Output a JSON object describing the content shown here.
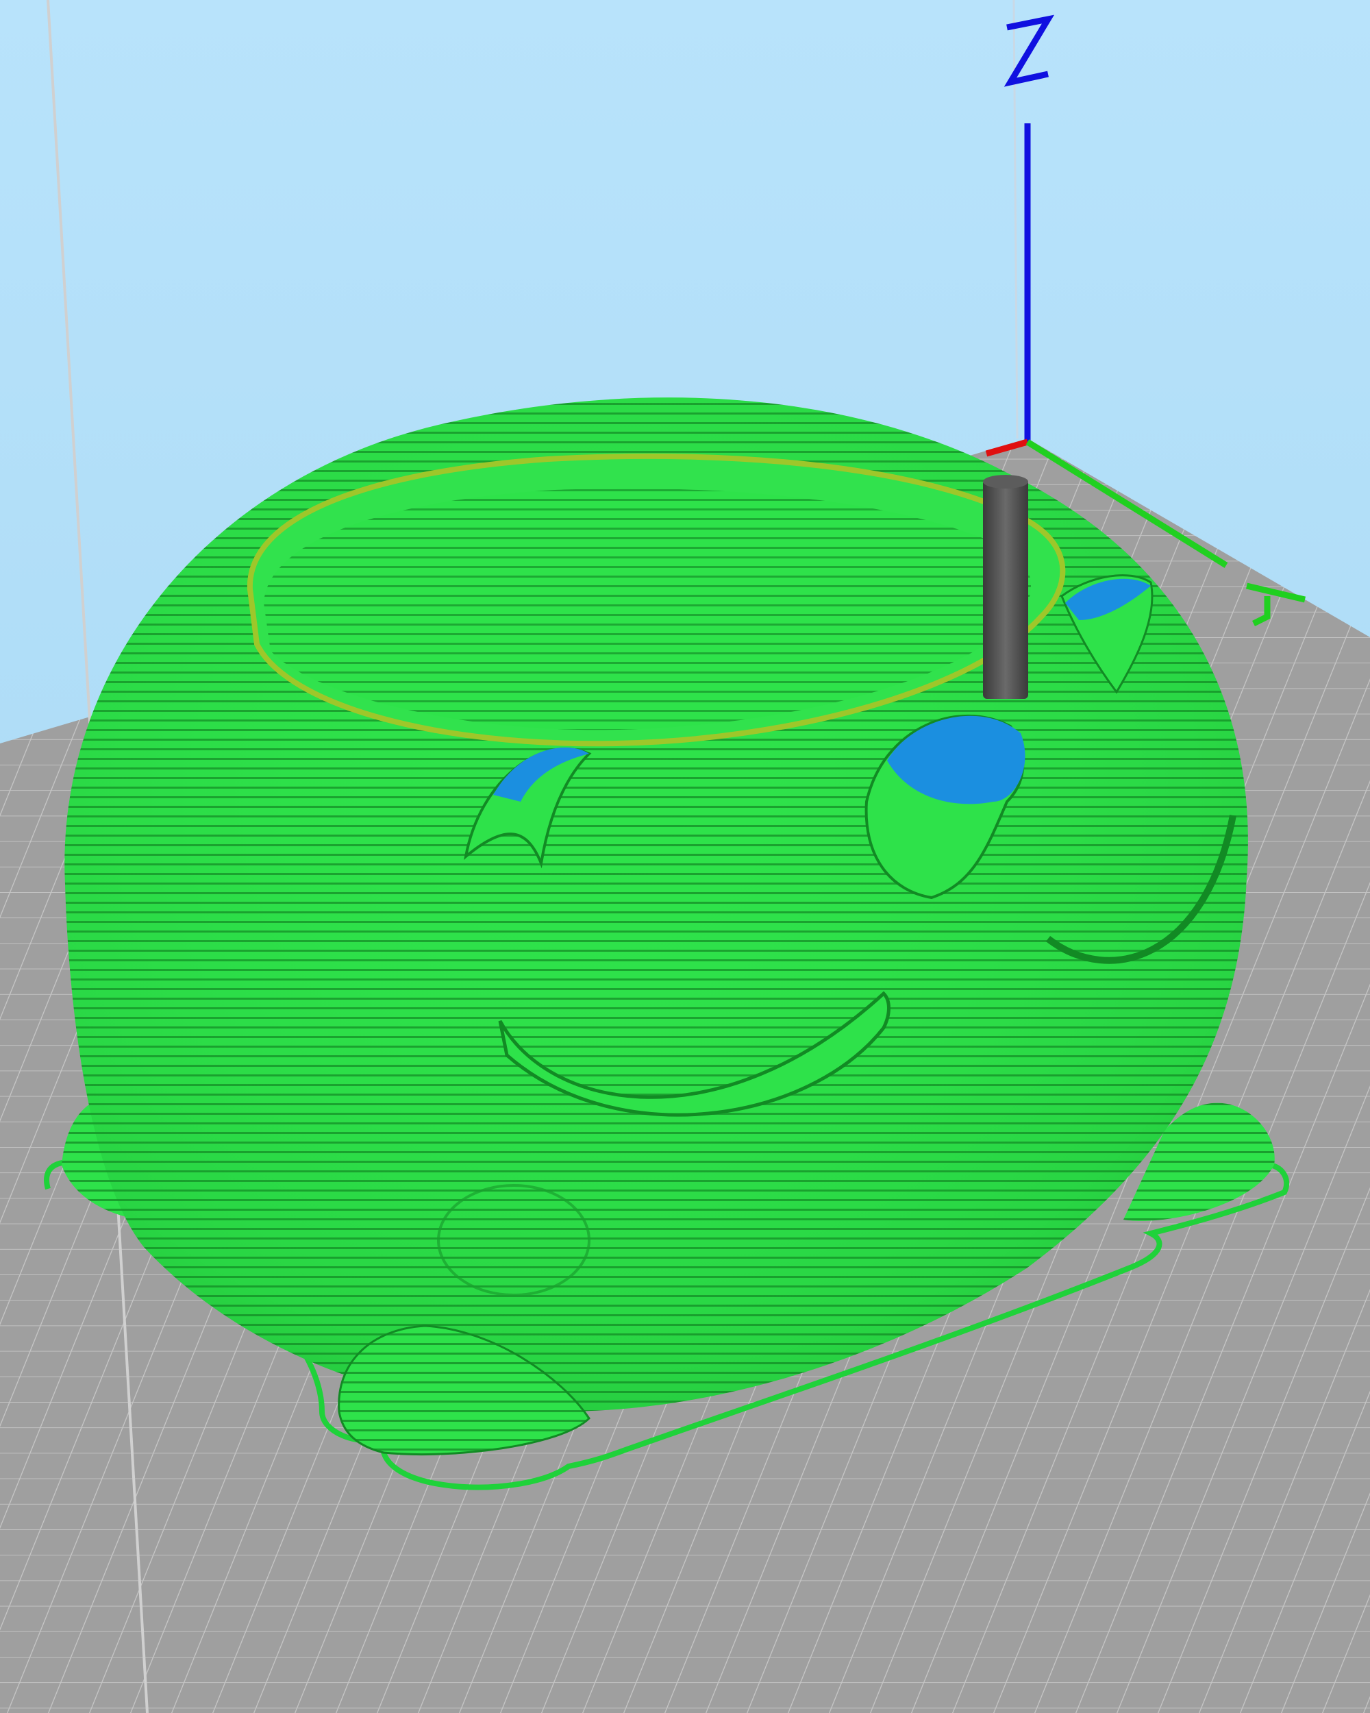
{
  "viewport": {
    "axes": {
      "z": {
        "label": "Z",
        "color": "#1010e0"
      },
      "y": {
        "label": "Y",
        "color": "#20d020"
      },
      "x": {
        "color": "#e01010"
      }
    },
    "colors": {
      "sky_top": "#b6e2fb",
      "sky_bottom": "#a6d6f3",
      "bed": "#9e9e9e",
      "bed_grid": "#bdbdbd",
      "model": "#2bdb45",
      "model_line": "#138a24",
      "overhang": "#1b8fe0",
      "nozzle": "#4a4a4a"
    },
    "icons": [
      "print-nozzle-icon",
      "axis-gizmo-icon"
    ]
  }
}
